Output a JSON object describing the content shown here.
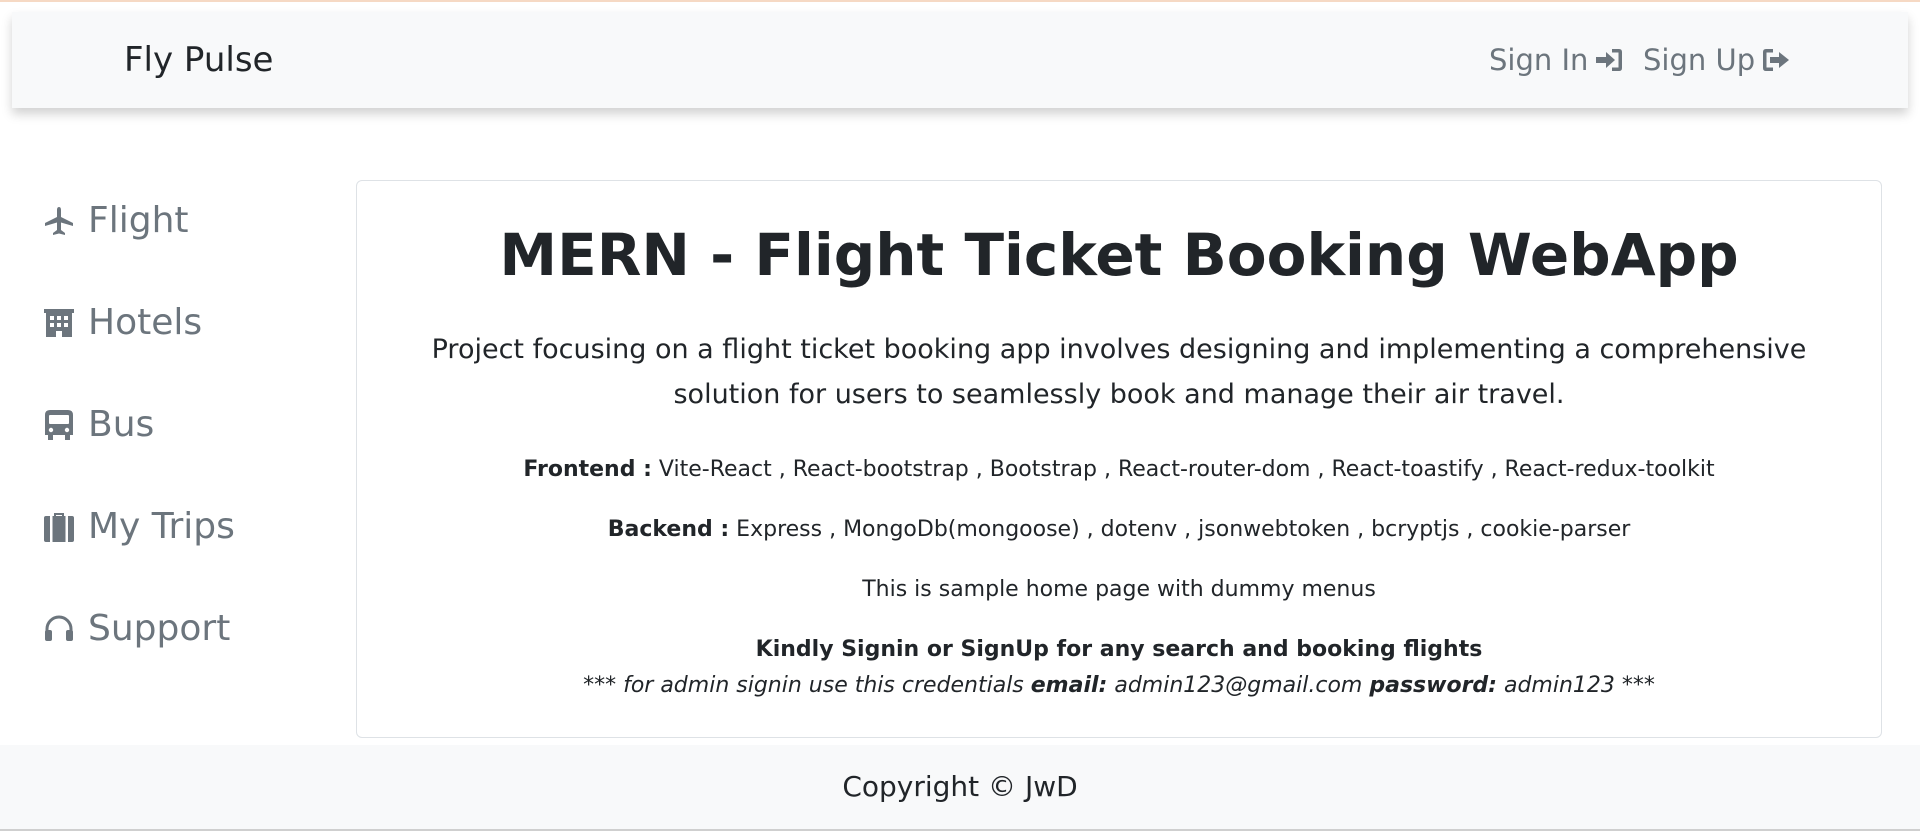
{
  "navbar": {
    "brand": "Fly Pulse",
    "signin_label": "Sign In",
    "signup_label": "Sign Up",
    "signin_icon": "sign-in-icon",
    "signup_icon": "sign-out-icon"
  },
  "sidebar": {
    "items": [
      {
        "label": "Flight",
        "icon": "plane-icon"
      },
      {
        "label": "Hotels",
        "icon": "building-icon"
      },
      {
        "label": "Bus",
        "icon": "bus-icon"
      },
      {
        "label": "My Trips",
        "icon": "suitcase-icon"
      },
      {
        "label": "Support",
        "icon": "headset-icon"
      }
    ]
  },
  "main": {
    "title": "MERN - Flight Ticket Booking WebApp",
    "lead": "Project focusing on a flight ticket booking app involves designing and implementing a comprehensive solution for users to seamlessly book and manage their air travel.",
    "frontend_label": "Frontend :",
    "frontend_value": " Vite-React , React-bootstrap , Bootstrap , React-router-dom , React-toastify , React-redux-toolkit",
    "backend_label": "Backend :",
    "backend_value": " Express , MongoDb(mongoose) , dotenv , jsonwebtoken , bcryptjs , cookie-parser",
    "sample_note": "This is sample home page with dummy menus",
    "kindly": "Kindly Signin or SignUp for any search and booking flights",
    "admin_prefix": "*** for admin signin use this credentials ",
    "admin_email_label": "email:",
    "admin_email": " admin123@gmail.com ",
    "admin_password_label": "password:",
    "admin_password": " admin123 ***"
  },
  "footer": {
    "copyright": "Copyright © JwD"
  },
  "colors": {
    "navbar_bg": "#f8f9fa",
    "muted_text": "#6c757d",
    "body_text": "#212529"
  }
}
